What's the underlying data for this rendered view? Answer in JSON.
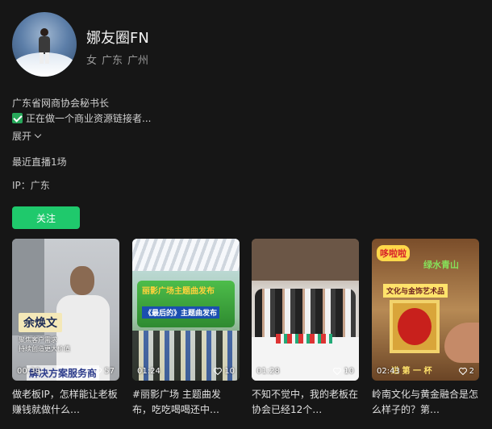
{
  "profile": {
    "name": "娜友圈FN",
    "gender": "女",
    "province": "广东",
    "city": "广州",
    "bio_line1": "广东省网商协会秘书长",
    "bio_line2": "正在做一个商业资源链接者...",
    "expand_label": "展开",
    "live_count": "最近直播1场",
    "ip": "IP：广东"
  },
  "actions": {
    "follow_label": "关注"
  },
  "colors": {
    "background": "#161616",
    "accent": "#1fc96c"
  },
  "videos": [
    {
      "duration": "00:38",
      "likes": "57",
      "overlay_tag": "余焕文",
      "overlay_sub1": "聚焦客户需求",
      "overlay_sub2": "持续创造更大价值",
      "overlay_banner": "解决方案服务商",
      "caption": "做老板IP，怎样能让老板赚钱就做什么…"
    },
    {
      "duration": "01:24",
      "likes": "10",
      "overlay_title": "丽影广场主题曲发布",
      "overlay_sub": "《最后的》主题曲发布",
      "caption": "#丽影广场 主题曲发布，吃吃喝喝还中…"
    },
    {
      "duration": "01:28",
      "likes": "10",
      "caption": "不知不觉中，我的老板在协会已经12个…"
    },
    {
      "duration": "02:43",
      "likes": "2",
      "overlay_tag1": "哆啦啦",
      "overlay_tag2": "绿水青山",
      "overlay_tag3": "文化与金饰艺术品",
      "overlay_banner": "进 第 一 杯",
      "caption": "岭南文化与黄金融合是怎么样子的？第…"
    }
  ]
}
